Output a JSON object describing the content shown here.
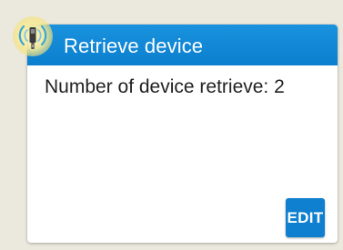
{
  "card": {
    "title": "Retrieve device",
    "body_text": "Number of device retrieve: 2",
    "icon": "wireless-device-icon"
  },
  "actions": {
    "edit_label": "EDIT"
  },
  "colors": {
    "header": "#0b7fcf",
    "accent": "#f5e48a",
    "button": "#0f7fcf"
  }
}
